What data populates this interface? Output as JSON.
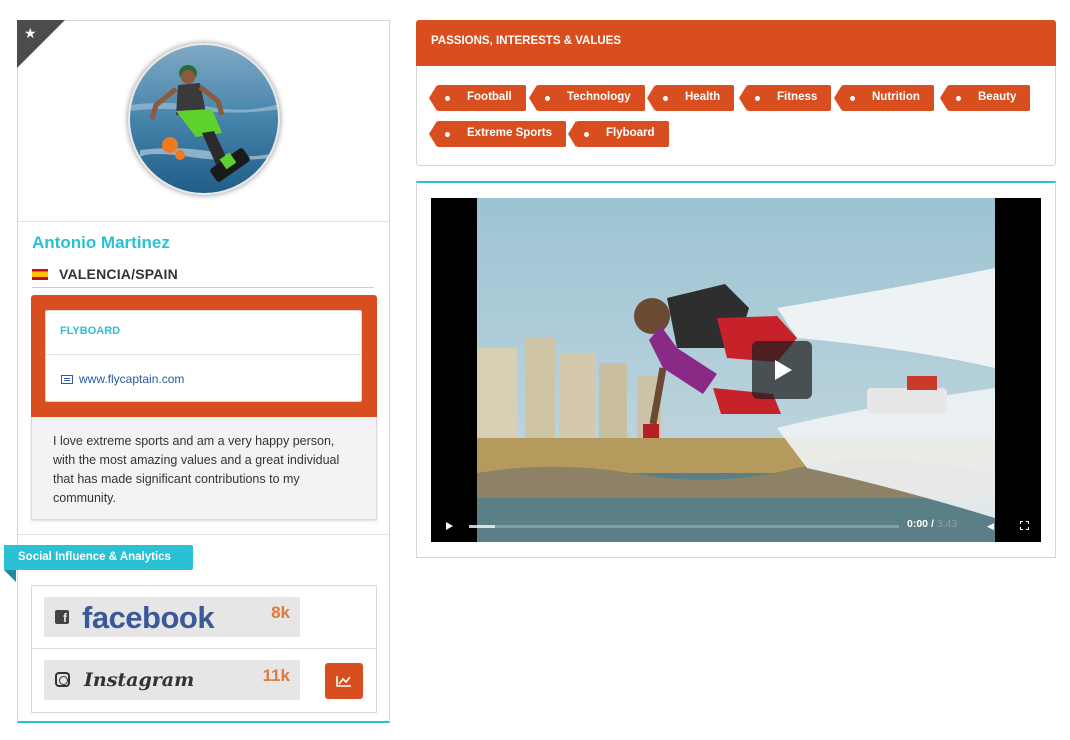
{
  "profile": {
    "name": "Antonio Martinez",
    "location": "VALENCIA/SPAIN",
    "featured_icon": "star-icon",
    "activity_card": {
      "title": "FLYBOARD",
      "link": "www.flycaptain.com"
    },
    "bio": "I love extreme sports and am a very happy person, with the most amazing values and a great individual that has made significant contributions to my community."
  },
  "social": {
    "section_label": "Social Influence & Analytics",
    "accounts": [
      {
        "network": "facebook",
        "logo_text": "facebook",
        "count": "8k",
        "icon": "facebook-icon"
      },
      {
        "network": "instagram",
        "logo_text": "Instagram",
        "count": "11k",
        "icon": "instagram-icon"
      }
    ],
    "analytics_icon": "trend-chart-icon"
  },
  "passions": {
    "title": "PASSIONS, INTERESTS & VALUES",
    "tags": [
      "Football",
      "Technology",
      "Health",
      "Fitness",
      "Nutrition",
      "Beauty",
      "Extreme Sports",
      "Flyboard"
    ]
  },
  "video": {
    "current_time": "0:00",
    "separator": "/",
    "duration": "3:43",
    "progress_fraction": 0.06
  },
  "colors": {
    "accent_orange": "#d84e1e",
    "accent_cyan": "#2bc1d4",
    "facebook_blue": "#3b5998",
    "count_orange": "#e07a3f"
  }
}
